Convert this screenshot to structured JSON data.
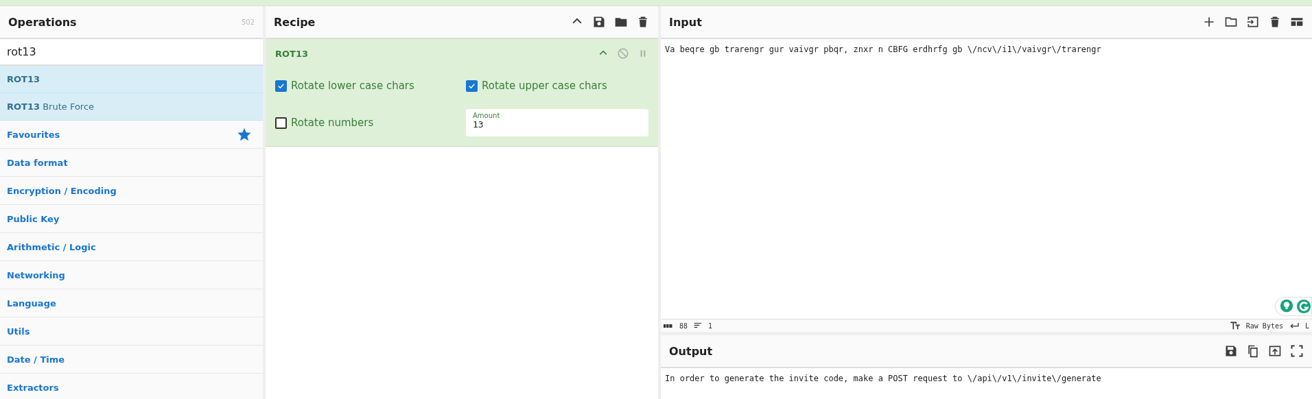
{
  "operations": {
    "title": "Operations",
    "count": "502",
    "search": {
      "value": "rot13"
    },
    "items": [
      {
        "kind": "result",
        "label": "**ROT13**"
      },
      {
        "kind": "result",
        "label": "**ROT13** Brute Force"
      },
      {
        "kind": "category",
        "label": "Favourites",
        "starred": true
      },
      {
        "kind": "category",
        "label": "Data format",
        "starred": false
      },
      {
        "kind": "category",
        "label": "Encryption / Encoding",
        "starred": false
      },
      {
        "kind": "category",
        "label": "Public Key",
        "starred": false
      },
      {
        "kind": "category",
        "label": "Arithmetic / Logic",
        "starred": false
      },
      {
        "kind": "category",
        "label": "Networking",
        "starred": false
      },
      {
        "kind": "category",
        "label": "Language",
        "starred": false
      },
      {
        "kind": "category",
        "label": "Utils",
        "starred": false
      },
      {
        "kind": "category",
        "label": "Date / Time",
        "starred": false
      },
      {
        "kind": "category",
        "label": "Extractors",
        "starred": false
      }
    ]
  },
  "recipe": {
    "title": "Recipe",
    "operation": {
      "name": "ROT13",
      "disabled": false,
      "paused": false,
      "options": [
        {
          "kind": "checkbox",
          "label": "Rotate lower case chars",
          "checked": true
        },
        {
          "kind": "checkbox",
          "label": "Rotate upper case chars",
          "checked": true
        },
        {
          "kind": "checkbox",
          "label": "Rotate numbers",
          "checked": false
        },
        {
          "kind": "number",
          "label": "Amount",
          "value": "13"
        }
      ]
    }
  },
  "input": {
    "title": "Input",
    "text": "Va beqre gb trarengr gur vaivgr pbqr, znxr n CBFG erdhrfg gb \\/ncv\\/i1\\/vaivgr\\/trarengr",
    "status": {
      "length": "88",
      "lines": "1",
      "encoding": "Raw Bytes",
      "eol": "L"
    }
  },
  "output": {
    "title": "Output",
    "text": "In order to generate the invite code, make a POST request to \\/api\\/v1\\/invite\\/generate"
  }
}
